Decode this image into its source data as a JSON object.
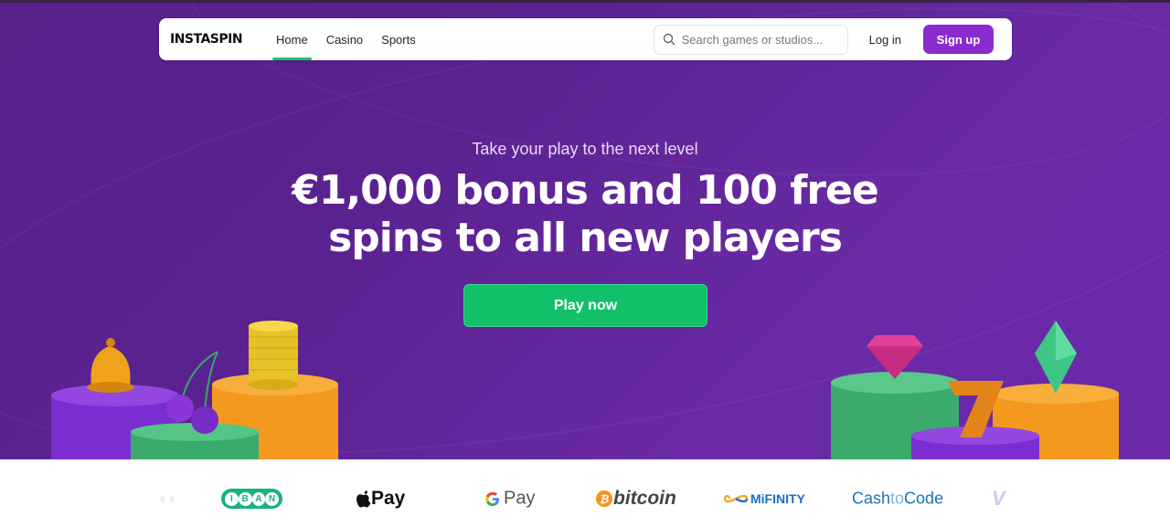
{
  "nav": {
    "logo": "INSTASPIN",
    "links": [
      {
        "label": "Home",
        "active": true
      },
      {
        "label": "Casino",
        "active": false
      },
      {
        "label": "Sports",
        "active": false
      }
    ],
    "search_placeholder": "Search games or studios...",
    "login_label": "Log in",
    "signup_label": "Sign up"
  },
  "hero": {
    "subtitle": "Take your play to the next level",
    "headline_line1": "€1,000 bonus and 100 free",
    "headline_line2": "spins to all new players",
    "cta_label": "Play now"
  },
  "payments": {
    "iban_letters": [
      "I",
      "B",
      "A",
      "N"
    ],
    "apple_pay": "Pay",
    "google_pay": "Pay",
    "bitcoin": "bitcoin",
    "mifinity": "MiFINITY",
    "cashtocode_cash": "Cash",
    "cashtocode_to": "to",
    "cashtocode_code": "Code",
    "partial_v": "V"
  },
  "colors": {
    "hero_purple": "#5b1f8a",
    "signup_purple": "#8a2bd0",
    "cta_green": "#12c06a",
    "active_underline": "#1bbf7a"
  }
}
